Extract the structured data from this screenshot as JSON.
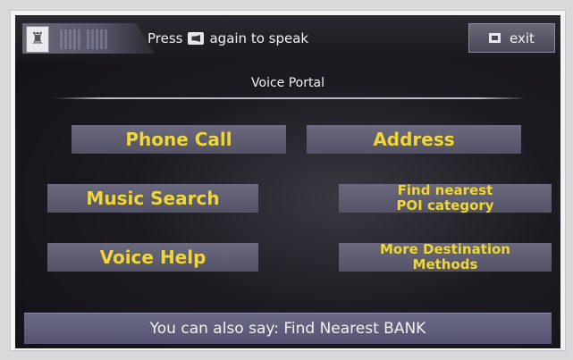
{
  "header": {
    "hint_prefix": "Press",
    "hint_suffix": "again to speak",
    "exit_label": "exit"
  },
  "portal": {
    "title": "Voice Portal",
    "options": {
      "phone_call": "Phone Call",
      "address": "Address",
      "music_search": "Music Search",
      "find_nearest_poi": "Find nearest\nPOI category",
      "voice_help": "Voice Help",
      "more_destination_methods": "More Destination\nMethods"
    }
  },
  "footer": {
    "tip": "You can also say: Find Nearest BANK"
  }
}
